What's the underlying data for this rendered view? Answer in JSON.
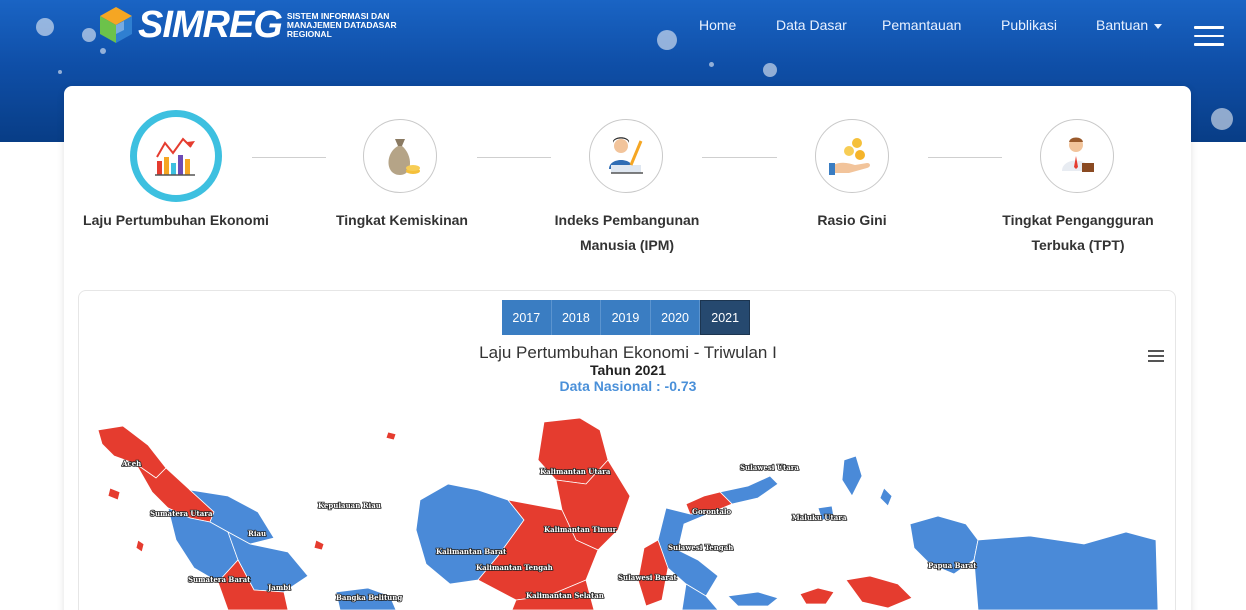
{
  "header": {
    "brand_name": "SIMREG",
    "brand_subtitle": "SISTEM INFORMASI DAN MANAJEMEN DATADASAR REGIONAL",
    "nav": [
      {
        "label": "Home",
        "has_caret": false
      },
      {
        "label": "Data Dasar",
        "has_caret": false
      },
      {
        "label": "Pemantauan",
        "has_caret": false
      },
      {
        "label": "Publikasi",
        "has_caret": false
      },
      {
        "label": "Bantuan",
        "has_caret": true
      }
    ],
    "menu_icon": "hamburger-icon"
  },
  "indicators": [
    {
      "label": "Laju Pertumbuhan Ekonomi",
      "icon": "growth-chart-icon",
      "active": true
    },
    {
      "label": "Tingkat Kemiskinan",
      "icon": "money-bag-icon",
      "active": false
    },
    {
      "label": "Indeks Pembangunan Manusia (IPM)",
      "icon": "person-writing-icon",
      "active": false
    },
    {
      "label": "Rasio Gini",
      "icon": "hand-coins-icon",
      "active": false
    },
    {
      "label": "Tingkat Pengangguran Terbuka (TPT)",
      "icon": "worker-icon",
      "active": false
    }
  ],
  "year_tabs": {
    "years": [
      "2017",
      "2018",
      "2019",
      "2020",
      "2021"
    ],
    "selected": "2021"
  },
  "chart": {
    "title": "Laju Pertumbuhan Ekonomi - Triwulan I",
    "subtitle": "Tahun 2021",
    "national": "Data Nasional : -0.73",
    "menu_icon": "chart-menu-icon",
    "colors": {
      "negative": "#e53c2f",
      "positive": "#4a8ad8"
    },
    "regions": [
      {
        "name": "Aceh",
        "color": "negative"
      },
      {
        "name": "Sumatera Utara",
        "color": "negative"
      },
      {
        "name": "Kepulauan Riau",
        "color": "negative"
      },
      {
        "name": "Riau",
        "color": "positive"
      },
      {
        "name": "Sumatera Barat",
        "color": "positive"
      },
      {
        "name": "Jambi",
        "color": "positive"
      },
      {
        "name": "Bangka Belitung",
        "color": "positive"
      },
      {
        "name": "Kalimantan Utara",
        "color": "negative"
      },
      {
        "name": "Kalimantan Timur",
        "color": "negative"
      },
      {
        "name": "Kalimantan Barat",
        "color": "positive"
      },
      {
        "name": "Kalimantan Tengah",
        "color": "negative"
      },
      {
        "name": "Kalimantan Selatan",
        "color": "negative"
      },
      {
        "name": "Sulawesi Utara",
        "color": "positive"
      },
      {
        "name": "Gorontalo",
        "color": "negative"
      },
      {
        "name": "Sulawesi Tengah",
        "color": "positive"
      },
      {
        "name": "Sulawesi Barat",
        "color": "negative"
      },
      {
        "name": "Maluku Utara",
        "color": "positive"
      },
      {
        "name": "Papua Barat",
        "color": "positive"
      }
    ]
  }
}
